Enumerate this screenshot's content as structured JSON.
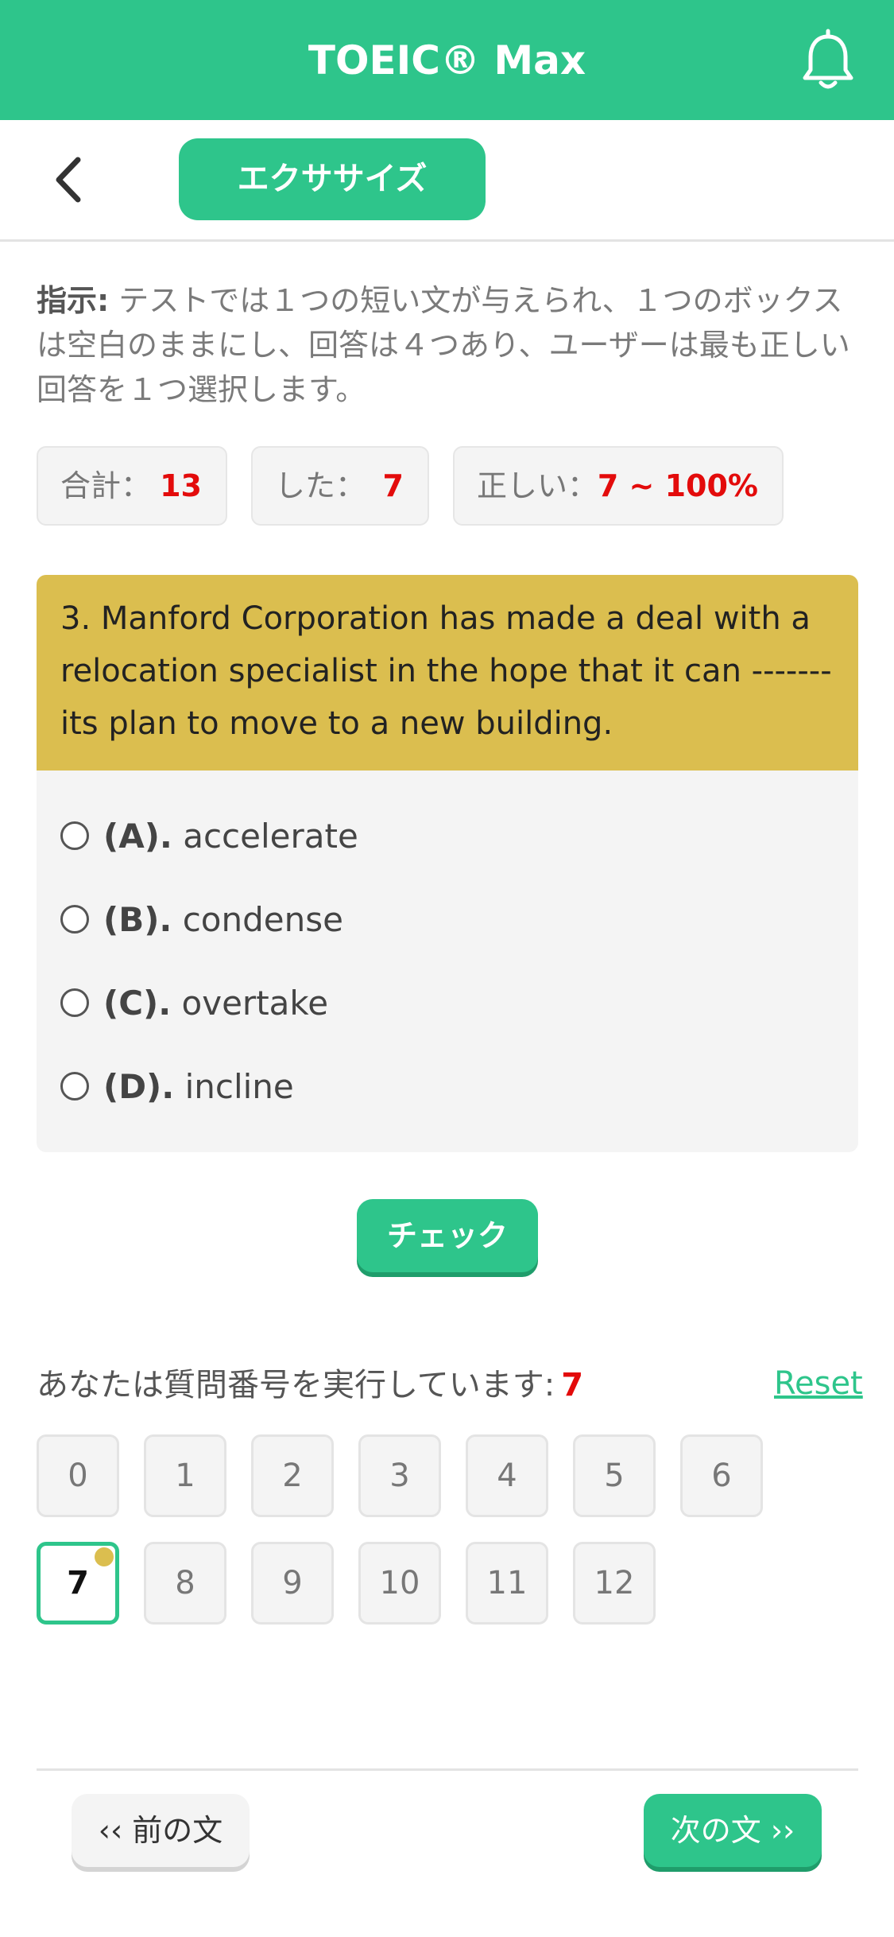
{
  "app": {
    "title": "TOEIC® Max"
  },
  "toolbar": {
    "exercise_label": "エクササイズ"
  },
  "instructions": {
    "label": "指示:",
    "text": " テストでは１つの短い文が与えられ、１つのボックスは空白のままにし、回答は４つあり、ユーザーは最も正しい回答を１つ選択します。"
  },
  "stats": {
    "total_label": "合計：",
    "total_value": "13",
    "done_label": "した：",
    "done_value": "7",
    "correct_label": "正しい：",
    "correct_value": "7 ~ 100%"
  },
  "question": {
    "text": "3. Manford Corporation has made a deal with a relocation specialist in the hope that it can ------- its plan to move to a new building.",
    "options": [
      {
        "letter": "(A).",
        "text": "accelerate"
      },
      {
        "letter": "(B).",
        "text": "condense"
      },
      {
        "letter": "(C).",
        "text": "overtake"
      },
      {
        "letter": "(D).",
        "text": "incline"
      }
    ]
  },
  "actions": {
    "check_label": "チェック",
    "prev_label": "‹‹ 前の文",
    "next_label": "次の文 ››",
    "reset_label": "Reset"
  },
  "progress": {
    "label": "あなたは質問番号を実行しています:",
    "current": "7",
    "numbers": [
      "0",
      "1",
      "2",
      "3",
      "4",
      "5",
      "6",
      "7",
      "8",
      "9",
      "10",
      "11",
      "12"
    ]
  },
  "colors": {
    "primary": "#2ec58b",
    "question_bg": "#dbbe4f",
    "highlight": "#e30b0b"
  },
  "icons": {
    "back": "chevron-left-icon",
    "notifications": "bell-icon"
  }
}
